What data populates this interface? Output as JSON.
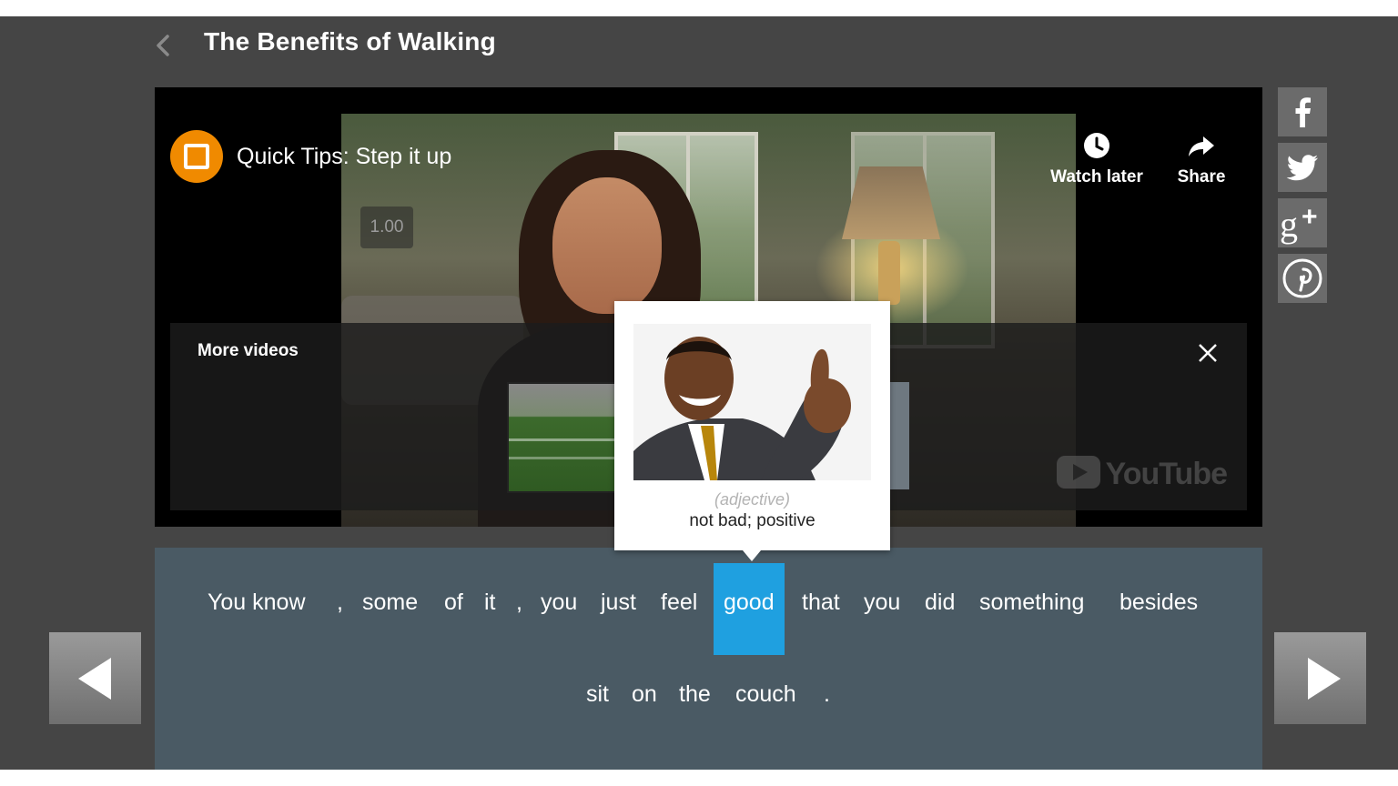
{
  "page": {
    "title": "The Benefits of Walking"
  },
  "video": {
    "title": "Quick Tips: Step it up",
    "speed": "1.00",
    "watch_later": "Watch later",
    "share": "Share",
    "more_videos": "More videos",
    "brand": "YouTube"
  },
  "social": [
    "facebook-icon",
    "twitter-icon",
    "google-plus-icon",
    "pinterest-icon"
  ],
  "popup": {
    "part_of_speech": "(adjective)",
    "definition": "not bad; positive"
  },
  "transcript": {
    "highlight_color": "#1fa0e0",
    "words": [
      "You know",
      ",",
      "some",
      "of",
      "it",
      ",",
      "you",
      "just",
      "feel",
      "good",
      "that",
      "you",
      "did",
      "something",
      "besides",
      "sit",
      "on",
      "the",
      "couch",
      "."
    ],
    "selected_word": "good"
  }
}
